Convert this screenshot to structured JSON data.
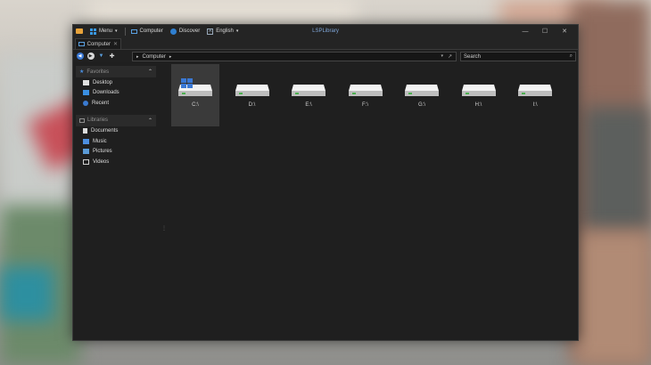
{
  "titlebar": {
    "menu_label": "Menu",
    "computer_label": "Computer",
    "discover_label": "Discover",
    "language_label": "English",
    "window_title": "LSPLibrary"
  },
  "tabs": [
    {
      "label": "Computer"
    }
  ],
  "address": {
    "path": "Computer"
  },
  "search": {
    "placeholder": "Search"
  },
  "sidebar": {
    "favorites": {
      "label": "Favorites",
      "items": [
        {
          "label": "Desktop",
          "icon": "desktop-icon"
        },
        {
          "label": "Downloads",
          "icon": "downloads-icon"
        },
        {
          "label": "Recent",
          "icon": "recent-icon"
        }
      ]
    },
    "libraries": {
      "label": "Libraries",
      "items": [
        {
          "label": "Documents",
          "icon": "documents-icon"
        },
        {
          "label": "Music",
          "icon": "music-icon"
        },
        {
          "label": "Pictures",
          "icon": "pictures-icon"
        },
        {
          "label": "Videos",
          "icon": "videos-icon"
        }
      ]
    }
  },
  "drives": [
    {
      "label": "C:\\",
      "system": true,
      "selected": true
    },
    {
      "label": "D:\\"
    },
    {
      "label": "E:\\"
    },
    {
      "label": "F:\\"
    },
    {
      "label": "G:\\"
    },
    {
      "label": "H:\\"
    },
    {
      "label": "I:\\"
    }
  ],
  "colors": {
    "accent": "#3a78d4",
    "title_text": "#7fa6d8",
    "drive_light": "#4caf50"
  }
}
